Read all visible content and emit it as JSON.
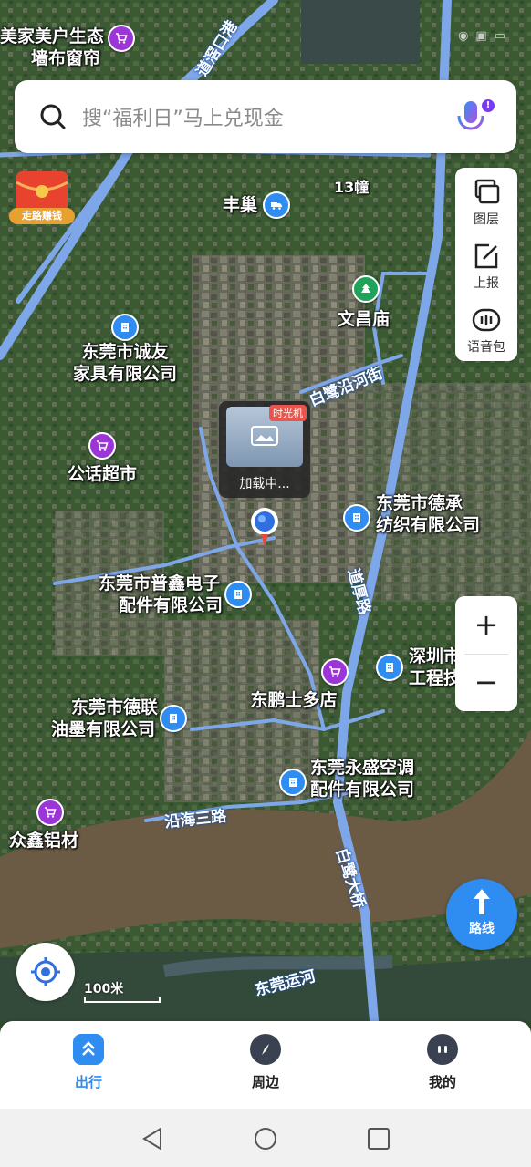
{
  "search": {
    "placeholder": "搜“福利日”马上兑现金"
  },
  "promo": {
    "label": "走路赚钱"
  },
  "right_panel": [
    {
      "label": "图层",
      "icon": "layers-icon"
    },
    {
      "label": "上报",
      "icon": "report-edit-icon"
    },
    {
      "label": "语音包",
      "icon": "voice-pack-icon"
    }
  ],
  "zoom": {
    "in": "+",
    "out": "−"
  },
  "route_button": {
    "label": "路线"
  },
  "time_machine": {
    "tag": "时光机",
    "loading": "加载中..."
  },
  "scale": {
    "label": "100米"
  },
  "map": {
    "pois": [
      {
        "lines": [
          "美家美户生态",
          "墙布窗帘"
        ],
        "icon": "shopping-cart-icon",
        "color": "purple"
      },
      {
        "lines": [
          "丰巢"
        ],
        "icon": "delivery-truck-icon",
        "color": "blue"
      },
      {
        "lines": [
          "文昌庙"
        ],
        "icon": "temple-icon",
        "color": "green"
      },
      {
        "lines": [
          "东莞市诚友",
          "家具有限公司"
        ],
        "icon": "company-icon",
        "color": "blue"
      },
      {
        "lines": [
          "公话超市"
        ],
        "icon": "shopping-cart-icon",
        "color": "purple"
      },
      {
        "lines": [
          "东莞市德承",
          "纺织有限公司"
        ],
        "icon": "company-icon",
        "color": "blue"
      },
      {
        "lines": [
          "东莞市普鑫电子",
          "配件有限公司"
        ],
        "icon": "company-icon",
        "color": "blue"
      },
      {
        "lines": [
          "深圳市",
          "工程技"
        ],
        "icon": "company-icon",
        "color": "blue"
      },
      {
        "lines": [
          "东鹏士多店"
        ],
        "icon": "shopping-cart-icon",
        "color": "purple"
      },
      {
        "lines": [
          "东莞市德联",
          "油墨有限公司"
        ],
        "icon": "company-icon",
        "color": "blue"
      },
      {
        "lines": [
          "东莞永盛空调",
          "配件有限公司"
        ],
        "icon": "company-icon",
        "color": "blue"
      },
      {
        "lines": [
          "众鑫铝材"
        ],
        "icon": "shopping-cart-icon",
        "color": "purple"
      }
    ],
    "roads": [
      "道滘口港",
      "白鹭沿河街",
      "道厚路",
      "沿海三路",
      "白鹭大桥",
      "东莞运河"
    ],
    "buildings": [
      "13幢"
    ]
  },
  "bottom_nav": [
    {
      "label": "出行",
      "active": true,
      "color": "#2f8cf0"
    },
    {
      "label": "周边",
      "active": false,
      "color": "#222222"
    },
    {
      "label": "我的",
      "active": false,
      "color": "#222222"
    }
  ],
  "colors": {
    "accent": "#2f8cf0",
    "road": "#7ea7ea",
    "river": "#6b5b45"
  }
}
